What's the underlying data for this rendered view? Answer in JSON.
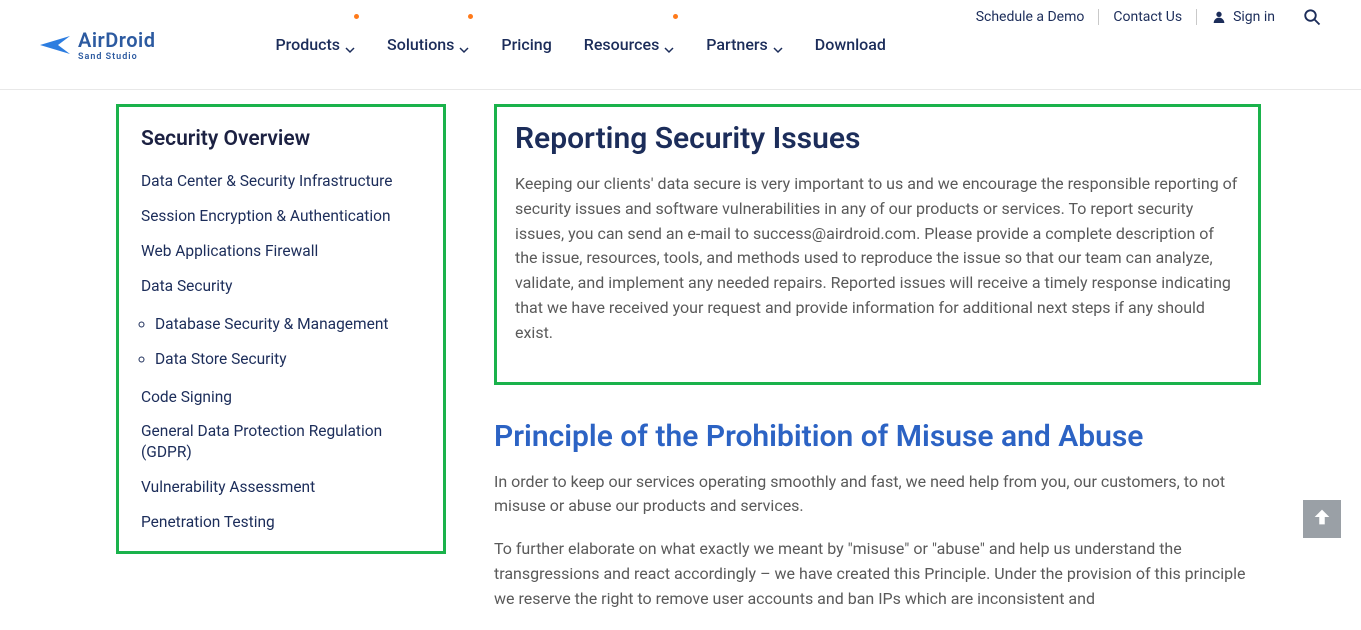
{
  "logo": {
    "text_main": "AirDroid",
    "text_sub": "Sand Studio"
  },
  "nav": {
    "products": "Products",
    "solutions": "Solutions",
    "pricing": "Pricing",
    "resources": "Resources",
    "partners": "Partners",
    "download": "Download"
  },
  "top": {
    "schedule_demo": "Schedule a Demo",
    "contact_us": "Contact Us",
    "sign_in": "Sign in"
  },
  "sidebar": {
    "title": "Security Overview",
    "items": [
      "Data Center & Security Infrastructure",
      "Session Encryption & Authentication",
      "Web Applications Firewall",
      "Data Security",
      "Code Signing",
      "General Data Protection Regulation (GDPR)",
      "Vulnerability Assessment",
      "Penetration Testing"
    ],
    "data_security_sub": [
      "Database Security & Management",
      "Data Store Security"
    ]
  },
  "content": {
    "section1": {
      "heading": "Reporting Security Issues",
      "body": "Keeping our clients' data secure is very important to us and we encourage the responsible reporting of security issues and software vulnerabilities in any of our products or services. To report security issues, you can send an e-mail to success@airdroid.com. Please provide a complete description of the issue, resources, tools, and methods used to reproduce the issue so that our team can analyze, validate, and implement any needed repairs. Reported issues will receive a timely response indicating that we have received your request and provide information for additional next steps if any should exist."
    },
    "section2": {
      "heading": "Principle of the Prohibition of Misuse and Abuse",
      "p1": "In order to keep our services operating smoothly and fast, we need help from you, our customers, to not misuse or abuse our products and services.",
      "p2": "To further elaborate on what exactly we meant by \"misuse\" or \"abuse\" and help us understand the transgressions and react accordingly – we have created this Principle. Under the provision of this principle we reserve the right to remove user accounts and ban IPs which are inconsistent and"
    }
  }
}
